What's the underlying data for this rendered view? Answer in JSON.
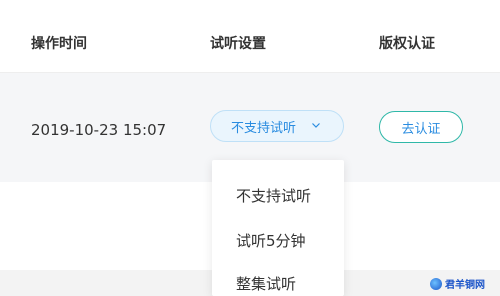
{
  "table": {
    "headers": {
      "operation_time": "操作时间",
      "preview_settings": "试听设置",
      "copyright_cert": "版权认证"
    },
    "row": {
      "time": "2019-10-23 15:07",
      "preview_value": "不支持试听",
      "certify_button": "去认证"
    }
  },
  "dropdown": {
    "options": [
      "不支持试听",
      "试听5分钟",
      "整集试听"
    ]
  },
  "watermark": {
    "text": "君羊铜网"
  },
  "colors": {
    "accent_blue": "#2a8ce0",
    "select_bg": "#eaf5fd",
    "button_border": "#2fb8a8",
    "row_bg": "#f5f6f8"
  },
  "icons": {
    "select_indicator": "chevron-down-icon"
  }
}
